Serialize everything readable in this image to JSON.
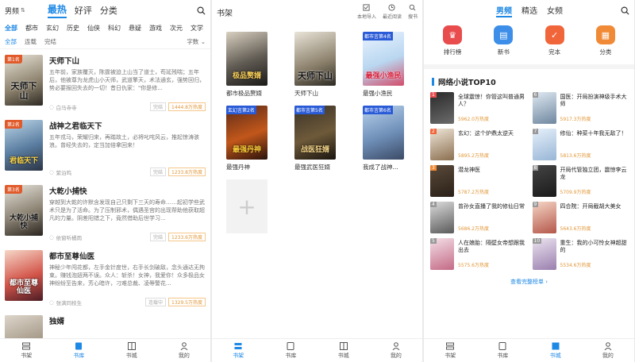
{
  "screen1": {
    "gender": "男频",
    "tabs": [
      {
        "label": "最热"
      },
      {
        "label": "好评"
      },
      {
        "label": "分类"
      }
    ],
    "categories": [
      {
        "label": "全部"
      },
      {
        "label": "都市"
      },
      {
        "label": "玄幻"
      },
      {
        "label": "历史"
      },
      {
        "label": "仙侠"
      },
      {
        "label": "科幻"
      },
      {
        "label": "悬疑"
      },
      {
        "label": "游戏"
      },
      {
        "label": "次元"
      },
      {
        "label": "文学"
      }
    ],
    "filters": [
      {
        "label": "全部"
      },
      {
        "label": "连载"
      },
      {
        "label": "完结"
      }
    ],
    "sort": "字数",
    "books": [
      {
        "title": "天师下山",
        "desc": "五年前，家族覆灭，陈霆被迫上山当了道士，苟延残喘；五年后，他被尊为龙虎山小天师，武道擎天，术法通玄，强势回归，势必要报回失去的一切！昔日仇家：\"你是修...",
        "author": "白马寺寺",
        "status": "完结",
        "heat": "1444.8万热度",
        "cover_text": "天师下山",
        "rank": "第1名"
      },
      {
        "title": "战神之君临天下",
        "desc": "五年戎马，荣耀归来，再踏故土，必将叱咤风云，推起惊涛骇浪。曾经失去的，定当加倍拿回来！",
        "author": "紫泊鸣",
        "status": "完结",
        "heat": "1233.8万热度",
        "cover_text": "君临天下",
        "rank": "第2名"
      },
      {
        "title": "大乾小捕快",
        "desc": "穿越到大乾的许默含发现自己只剩下三天的寿命……起初学些武术只是为了活命。为了压制邪术，偶遇圣宫的出现帮助他获取超凡的力量。阴差阳错之下，竟然借助后世学习...",
        "author": "依窗听橘雨",
        "status": "完结",
        "heat": "1233.6万热度",
        "cover_text": "大乾小捕快",
        "rank": "第3名"
      },
      {
        "title": "都市至尊仙医",
        "desc": "神秘少年闯花都，左手金针度世，右手长剑破敌，念头通达无拘束。赚钱泡妞两不误。众人：斩杀！女神，我爱你！众多极品女神纷纷至告来，芳心暗许，刁难总裁、凌辱警花...",
        "author": "张满同枝生",
        "status": "连载中",
        "heat": "1329.5万热度",
        "cover_text": "都市至尊仙医",
        "rank": ""
      },
      {
        "title": "独婿",
        "desc": "",
        "author": "",
        "status": "",
        "heat": "",
        "cover_text": "",
        "rank": ""
      }
    ]
  },
  "screen2": {
    "title": "书架",
    "actions": [
      {
        "label": "本地导入",
        "icon": "check-box-icon"
      },
      {
        "label": "最近阅读",
        "icon": "clock-icon"
      },
      {
        "label": "搜书",
        "icon": "search-icon"
      }
    ],
    "books": [
      {
        "title": "都市极品赘婿",
        "cover_text": "极品赘婿",
        "rank": ""
      },
      {
        "title": "天师下山",
        "cover_text": "天师下山",
        "rank": ""
      },
      {
        "title": "最强小渔民",
        "cover_text": "最强小渔民",
        "rank": "都市言第4名"
      },
      {
        "title": "最强丹神",
        "cover_text": "最强丹神",
        "rank": "玄幻言第2名"
      },
      {
        "title": "最强武医狂婿",
        "cover_text": "战医狂婿",
        "rank": "都市言第5名"
      },
      {
        "title": "我成了战神...",
        "cover_text": "",
        "rank": "都市言第6名"
      }
    ],
    "add_symbol": "+"
  },
  "screen3": {
    "tabs": [
      {
        "label": "男频"
      },
      {
        "label": "精选"
      },
      {
        "label": "女频"
      }
    ],
    "entries": [
      {
        "label": "排行榜",
        "icon": "trophy-icon",
        "color": "#e84c4c"
      },
      {
        "label": "新书",
        "icon": "book-icon",
        "color": "#3c8ee8"
      },
      {
        "label": "完本",
        "icon": "check-icon",
        "color": "#f0663a"
      },
      {
        "label": "分类",
        "icon": "grid-icon",
        "color": "#f08a36"
      }
    ],
    "section_title": "网络小说TOP10",
    "top10": [
      {
        "num": "1",
        "title": "全球震惊！你管这叫普通男人？",
        "heat": "5962.0万热度"
      },
      {
        "num": "6",
        "title": "国医：开局扮演神级手术大师",
        "heat": "5917.3万热度"
      },
      {
        "num": "2",
        "title": "玄幻：这个炉鼎太逆天",
        "heat": "5895.2万热度"
      },
      {
        "num": "7",
        "title": "修仙：种菜十年我无敌了！",
        "heat": "5813.6万热度"
      },
      {
        "num": "3",
        "title": "潜龙神医",
        "heat": "5787.2万热度"
      },
      {
        "num": "8",
        "title": "开局代管独立团，震惊李云龙",
        "heat": "5709.9万热度"
      },
      {
        "num": "4",
        "title": "曾孙女直播了我的修仙日常",
        "heat": "5686.2万热度"
      },
      {
        "num": "9",
        "title": "四合院：开局截胡大美女",
        "heat": "5643.6万热度"
      },
      {
        "num": "5",
        "title": "人在娘胎：隔壁女帝想跟我出去",
        "heat": "5575.6万热度"
      },
      {
        "num": "10",
        "title": "重生：我的小可怜女神超甜的",
        "heat": "5534.6万热度"
      }
    ],
    "more": "查看完整榜单 ›"
  },
  "tabbar": [
    {
      "label": "书架"
    },
    {
      "label": "书库"
    },
    {
      "label": "书城"
    },
    {
      "label": "我的"
    }
  ],
  "colors": {
    "accent": "#1e88e5",
    "heat": "#e0983a"
  }
}
